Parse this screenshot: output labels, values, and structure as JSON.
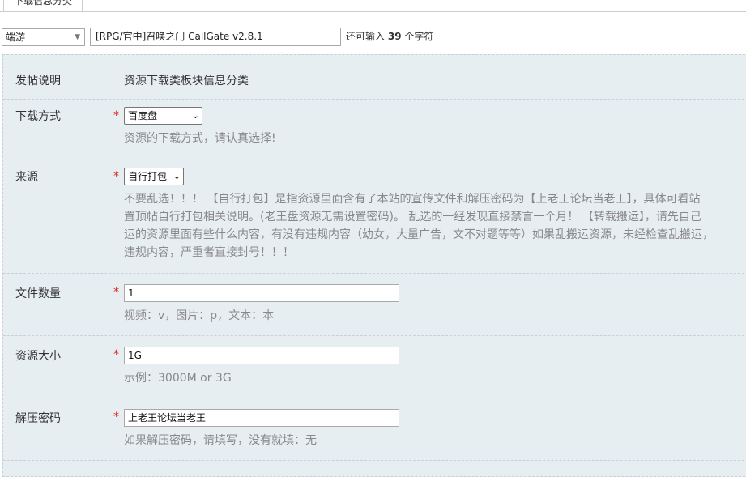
{
  "tab": {
    "label": "下载信息分类"
  },
  "topbar": {
    "category_select": "端游",
    "title_value": "[RPG/官中]召唤之门 CallGate v2.8.1",
    "counter_prefix": "还可输入",
    "counter_value": "39",
    "counter_suffix": "个字符"
  },
  "form": {
    "post_desc": {
      "label": "发帖说明",
      "value": "资源下载类板块信息分类"
    },
    "download_method": {
      "label": "下载方式",
      "required": "*",
      "selected": "百度盘",
      "hint": "资源的下载方式，请认真选择!"
    },
    "source": {
      "label": "来源",
      "required": "*",
      "selected": "自行打包",
      "hint_lines": [
        "不要乱选！！！ 【自行打包】是指资源里面含有了本站的宣传文件和解压密码为【上老王论坛当老王】，具体可看站",
        "置顶帖自行打包相关说明。(老王盘资源无需设置密码)。 乱选的一经发现直接禁言一个月！ 【转载搬运】，请先自己",
        "运的资源里面有些什么内容，有没有违规内容（幼女，大量广告，文不对题等等）如果乱搬运资源，未经检查乱搬运，",
        "违规内容，严重者直接封号！！！"
      ]
    },
    "file_count": {
      "label": "文件数量",
      "required": "*",
      "value": "1",
      "hint": "视频：v，图片：p，文本：本"
    },
    "resource_size": {
      "label": "资源大小",
      "required": "*",
      "value": "1G",
      "hint": "示例：3000M or 3G"
    },
    "unzip_password": {
      "label": "解压密码",
      "required": "*",
      "value": "上老王论坛当老王",
      "hint": "如果解压密码，请填写，没有就填：无"
    }
  },
  "icons": {
    "dropdown": "chevron-down-icon"
  }
}
